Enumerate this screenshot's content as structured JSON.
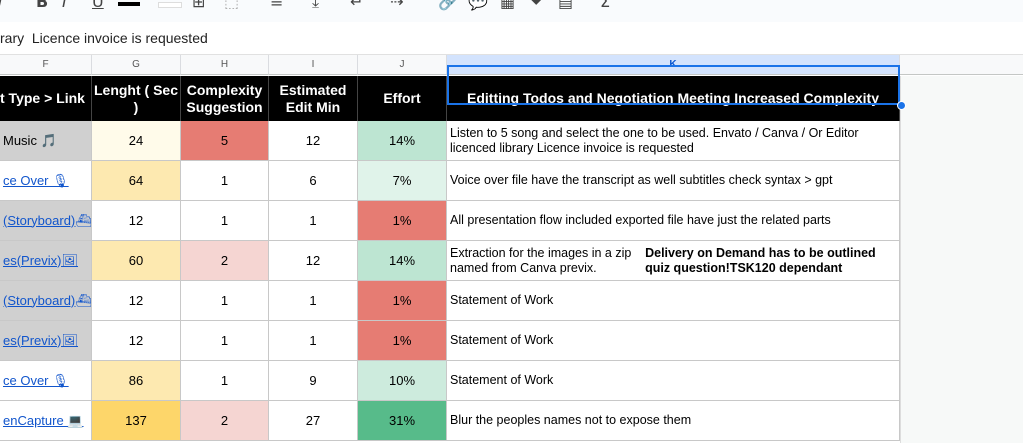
{
  "toolbar": {
    "icons": [
      "italic-icon",
      "underline-icon",
      "text-color-icon",
      "fill-color-icon",
      "borders-icon",
      "merge-icon",
      "align-icon",
      "valign-icon",
      "wrap-icon",
      "rotate-icon",
      "link-icon",
      "comment-icon",
      "chart-icon",
      "filter-icon",
      "table-icon",
      "functions-icon"
    ]
  },
  "formula_bar": {
    "text": "rary  Licence invoice is requested"
  },
  "column_headers": [
    "F",
    "G",
    "H",
    "I",
    "J",
    "K"
  ],
  "header_row": {
    "f": "t Type > Link",
    "g": "Lenght ( Sec )",
    "h": "Complexity Suggestion",
    "i": "Estimated Edit Min",
    "j": "Effort",
    "k": "Editting Todos and Negotiation Meeting Increased Complexity"
  },
  "rows": [
    {
      "f": "Music 🎵",
      "f_link": false,
      "g": "24",
      "h": "5",
      "i": "12",
      "j": "14%",
      "k": "Listen to 5 song and select the one to be used. Envato / Canva / Or Editor licenced library  Licence invoice is requested",
      "k_bold": ""
    },
    {
      "f": "ce Over 🎙",
      "f_link": true,
      "g": "64",
      "h": "1",
      "i": "6",
      "j": "7%",
      "k": "Voice over file have the transcript as well subtitles check syntax > gpt",
      "k_bold": ""
    },
    {
      "f": "(Storyboard)⛴",
      "f_link": true,
      "g": "12",
      "h": "1",
      "i": "1",
      "j": "1%",
      "k": "All presentation flow included exported file have just the related parts",
      "k_bold": ""
    },
    {
      "f": "es(Previx)🖼",
      "f_link": true,
      "g": "60",
      "h": "2",
      "i": "12",
      "j": "14%",
      "k": "Extraction for the images in a zip named from Canva previx. ",
      "k_bold": "Delivery on Demand has to be outlined quiz question!TSK120 dependant"
    },
    {
      "f": "(Storyboard)⛴",
      "f_link": true,
      "g": "12",
      "h": "1",
      "i": "1",
      "j": "1%",
      "k": "Statement of Work",
      "k_bold": ""
    },
    {
      "f": "es(Previx)🖼",
      "f_link": true,
      "g": "12",
      "h": "1",
      "i": "1",
      "j": "1%",
      "k": "Statement of Work",
      "k_bold": ""
    },
    {
      "f": "ce Over 🎙",
      "f_link": true,
      "g": "86",
      "h": "1",
      "i": "9",
      "j": "10%",
      "k": "Statement of Work",
      "k_bold": ""
    },
    {
      "f": "enCapture 💻",
      "f_link": true,
      "g": "137",
      "h": "2",
      "i": "27",
      "j": "31%",
      "k": "Blur the peoples names not to expose them",
      "k_bold": ""
    }
  ],
  "colors": {
    "f_bg": [
      "#d0d0d0",
      "#ffffff",
      "#d0d0d0",
      "#d0d0d0",
      "#d0d0d0",
      "#d0d0d0",
      "#ffffff",
      "#ffffff"
    ],
    "g_bg": [
      "#fffbea",
      "#fde9b0",
      "#ffffff",
      "#fde9b0",
      "#ffffff",
      "#ffffff",
      "#fde9b0",
      "#fdd66a"
    ],
    "h_bg": [
      "#e67c73",
      "#ffffff",
      "#ffffff",
      "#f5d5d2",
      "#ffffff",
      "#ffffff",
      "#ffffff",
      "#f5d5d2"
    ],
    "j_bg": [
      "#bde5d2",
      "#e0f3ea",
      "#e67c73",
      "#bde5d2",
      "#e67c73",
      "#e67c73",
      "#cdebdd",
      "#57bb8a"
    ]
  }
}
